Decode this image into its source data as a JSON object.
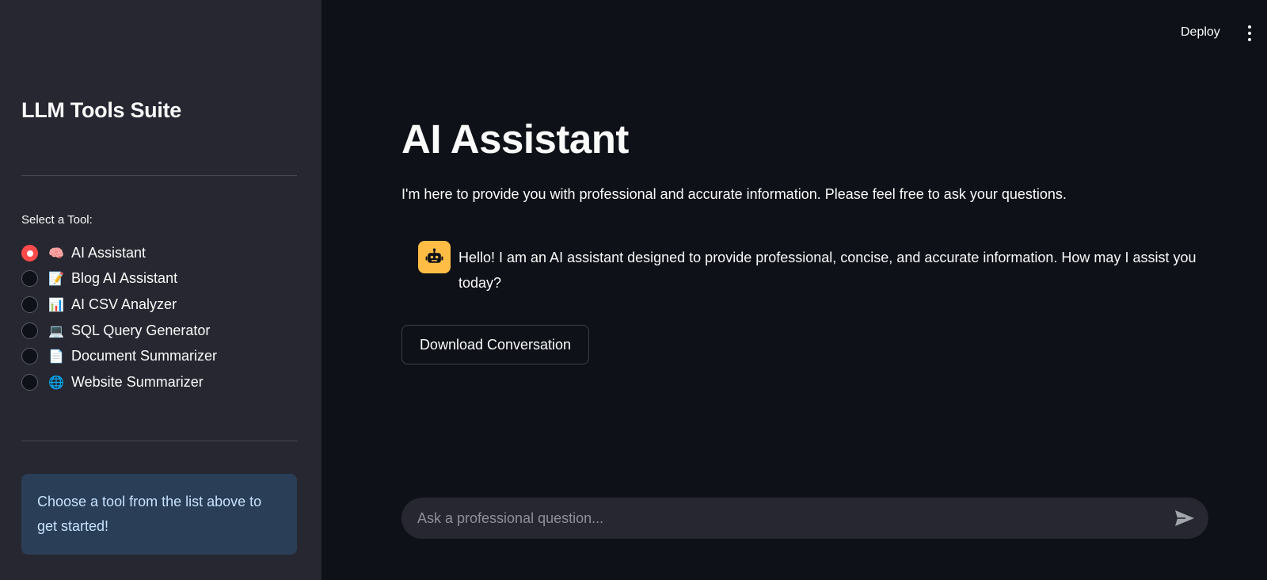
{
  "sidebar": {
    "title": "LLM Tools Suite",
    "select_label": "Select a Tool:",
    "tools": [
      {
        "emoji": "🧠",
        "label": "AI Assistant",
        "selected": true
      },
      {
        "emoji": "📝",
        "label": "Blog AI Assistant",
        "selected": false
      },
      {
        "emoji": "📊",
        "label": "AI CSV Analyzer",
        "selected": false
      },
      {
        "emoji": "💻",
        "label": "SQL Query Generator",
        "selected": false
      },
      {
        "emoji": "📄",
        "label": "Document Summarizer",
        "selected": false
      },
      {
        "emoji": "🌐",
        "label": "Website Summarizer",
        "selected": false
      }
    ],
    "info": "Choose a tool from the list above to get started!"
  },
  "header": {
    "deploy_label": "Deploy",
    "menu_icon": "kebab-menu-icon"
  },
  "main": {
    "title": "AI Assistant",
    "description": "I'm here to provide you with professional and accurate information. Please feel free to ask your questions.",
    "messages": [
      {
        "role": "assistant",
        "avatar_icon": "robot-icon",
        "text": "Hello! I am an AI assistant designed to provide professional, concise, and accurate information. How may I assist you today?"
      }
    ],
    "download_label": "Download Conversation",
    "chat_input": {
      "placeholder": "Ask a professional question...",
      "value": ""
    },
    "send_icon": "send-icon"
  },
  "colors": {
    "sidebar_bg": "#262730",
    "main_bg": "#0e1117",
    "accent": "#ff4b4b",
    "avatar_bg": "#ffbd45",
    "info_bg": "#2a3e57",
    "info_text": "#c7e2ff"
  }
}
